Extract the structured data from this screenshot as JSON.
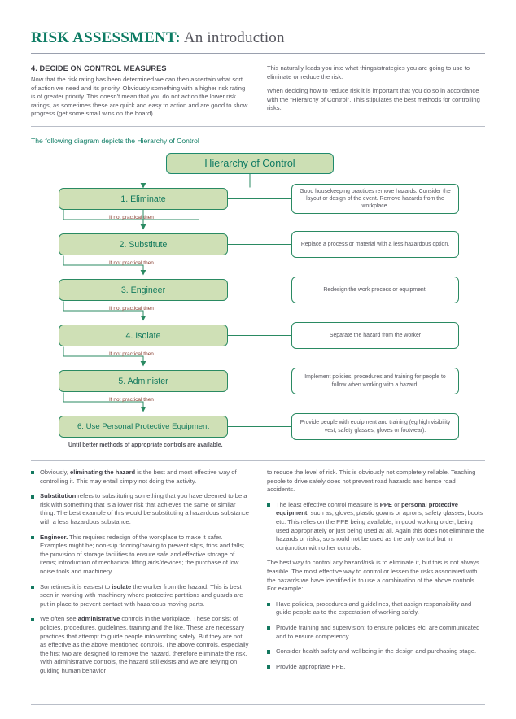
{
  "document": {
    "title_main": "RISK ASSESSMENT:",
    "title_sub": " An introduction"
  },
  "intro": {
    "section_number_title": "4. DECIDE ON CONTROL MEASURES",
    "left_paragraph": "Now that the risk rating has been determined we can then ascertain what sort of action we need and its priority. Obviously something with a higher risk rating is of greater priority. This doesn't mean that you do not action the lower risk ratings, as sometimes these are quick and easy to action and are good to show progress (get some small wins on the board).",
    "right_paragraph_1": "This naturally leads you into what things/strategies you are going to use to eliminate or reduce the risk.",
    "right_paragraph_2": "When deciding how to reduce risk it is important that you do so in accordance with the \"Hierarchy of Control\". This stipulates the best methods for controlling risks:"
  },
  "diagram": {
    "caption": "The following diagram depicts the Hierarchy of Control",
    "header_box": "Hierarchy of Control",
    "connector_label": "If not practical then",
    "footnote": "Until better methods of appropriate controls are available.",
    "levels": [
      {
        "label": "1. Eliminate",
        "description": "Good housekeeping practices remove hazards. Consider the layout or design of the event. Remove hazards from the workplace."
      },
      {
        "label": "2. Substitute",
        "description": "Replace a process or material with a less hazardous option."
      },
      {
        "label": "3. Engineer",
        "description": "Redesign the work process or equipment."
      },
      {
        "label": "4. Isolate",
        "description": "Separate the hazard from the worker"
      },
      {
        "label": "5. Administer",
        "description": "Implement policies, procedures and training for people to follow when working with a hazard."
      },
      {
        "label": "6. Use Personal Protective Equipment",
        "description": "Provide people with equipment and training (eg high visibility vest, safety glasses, gloves or footwear)."
      }
    ]
  },
  "notes": {
    "left_bullets": [
      {
        "lead": "",
        "pre": "Obviously, ",
        "bold": "eliminating the hazard",
        "post": " is the best and most effective way of controlling it. This may entail simply not doing the activity."
      },
      {
        "pre": "",
        "bold": "Substitution",
        "post": " refers to substituting something that you have deemed to be a risk with something that is a lower risk that achieves the same or similar thing. The best example of this would be substituting a hazardous substance with a less hazardous substance."
      },
      {
        "pre": "",
        "bold": "Engineer.",
        "post": " This requires redesign of the workplace to make it safer. Examples might be; non-slip flooring/paving to prevent slips, trips and falls; the provision of storage facilities to ensure safe and effective storage of items; introduction of mechanical lifting aids/devices; the purchase of low noise tools and machinery."
      },
      {
        "pre": "Sometimes it is easiest to ",
        "bold": "isolate",
        "post": " the worker from the hazard. This is best seen in working with machinery where protective partitions and guards are put in place to prevent contact with hazardous moving parts."
      },
      {
        "pre": "We often see ",
        "bold": "administrative",
        "post": " controls in the workplace. These consist of policies, procedures, guidelines, training and the like. These are necessary practices that attempt to guide people into working safely. But they are not as effective as the above mentioned controls. The above controls, especially the first two are designed to remove the hazard, therefore eliminate the risk. With administrative controls, the hazard still exists and we are relying on guiding human behavior"
      }
    ],
    "right_continuation": "to reduce the level of risk. This is obviously not completely reliable. Teaching people to drive safely does not prevent road hazards and hence road accidents.",
    "right_ppe_bullet": {
      "pre": "The least effective control measure is ",
      "bold1": "PPE",
      "mid": " or ",
      "bold2": "personal protective equipment",
      "post": ", such as; gloves, plastic gowns or aprons, safety glasses, boots etc. This relies on the PPE being available, in good working order, being used appropriately or just being used at all. Again this does not eliminate the hazards or risks, so should not be used as the only control but in conjunction with other controls."
    },
    "right_summary": "The best way to control any hazard/risk is to eliminate it, but this is not always feasible. The most effective way to control or lessen the risks associated with the hazards we have identified is to use a combination of the above controls. For example:",
    "right_bullets": [
      "Have policies, procedures and guidelines, that assign responsibility and guide people as to the expectation of working safely.",
      "Provide training and supervision; to ensure policies etc. are communicated and to ensure competency.",
      "Consider health safety and wellbeing in the design and purchasing stage.",
      "Provide appropriate PPE."
    ]
  },
  "colors": {
    "accent_teal": "#0c7b63",
    "box_green_fill": "#cfe0b6",
    "box_border": "#2a8a62",
    "label_red": "#8a4033",
    "body_text": "#55555d"
  }
}
